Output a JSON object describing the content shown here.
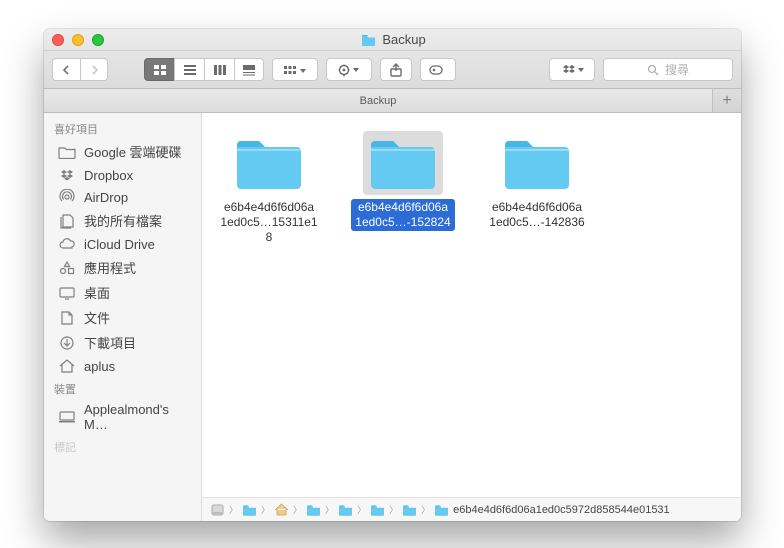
{
  "window": {
    "title": "Backup"
  },
  "toolbar": {
    "search_placeholder": "搜尋"
  },
  "tabs": [
    {
      "label": "Backup"
    }
  ],
  "sidebar": {
    "sections": [
      {
        "header": "喜好項目",
        "items": [
          {
            "icon": "folder",
            "label": "Google 雲端硬碟"
          },
          {
            "icon": "dropbox",
            "label": "Dropbox"
          },
          {
            "icon": "airdrop",
            "label": "AirDrop"
          },
          {
            "icon": "allfiles",
            "label": "我的所有檔案"
          },
          {
            "icon": "icloud",
            "label": "iCloud Drive"
          },
          {
            "icon": "apps",
            "label": "應用程式"
          },
          {
            "icon": "desktop",
            "label": "桌面"
          },
          {
            "icon": "documents",
            "label": "文件"
          },
          {
            "icon": "downloads",
            "label": "下載項目"
          },
          {
            "icon": "home",
            "label": "aplus"
          }
        ]
      },
      {
        "header": "裝置",
        "items": [
          {
            "icon": "mac",
            "label": "Applealmond's M…"
          }
        ]
      },
      {
        "header": "標記",
        "items": []
      }
    ]
  },
  "items": [
    {
      "line1": "e6b4e4d6f6d06a",
      "line2": "1ed0c5…15311e18",
      "selected": false
    },
    {
      "line1": "e6b4e4d6f6d06a",
      "line2": "1ed0c5…-152824",
      "selected": true
    },
    {
      "line1": "e6b4e4d6f6d06a",
      "line2": "1ed0c5…-142836",
      "selected": false
    }
  ],
  "pathbar": {
    "segments": [
      {
        "icon": "disk",
        "label": ""
      },
      {
        "icon": "folder",
        "label": ""
      },
      {
        "icon": "home",
        "label": ""
      },
      {
        "icon": "folder",
        "label": ""
      },
      {
        "icon": "folder",
        "label": ""
      },
      {
        "icon": "folder",
        "label": ""
      },
      {
        "icon": "folder",
        "label": ""
      },
      {
        "icon": "folder",
        "label": "e6b4e4d6f6d06a1ed0c5972d858544e01531"
      }
    ]
  },
  "colors": {
    "folder": "#64caf2",
    "folder_dark": "#45b8e8",
    "select": "#2b6cd7"
  }
}
